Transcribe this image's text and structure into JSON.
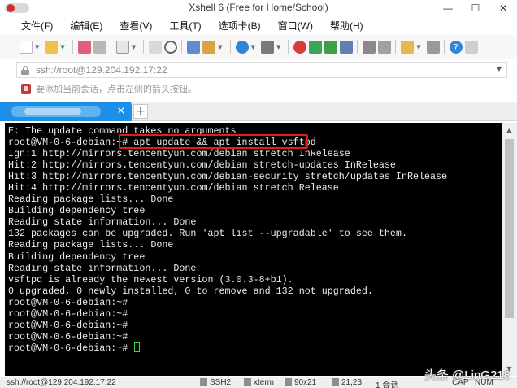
{
  "window": {
    "title": "Xshell 6 (Free for Home/School)",
    "minimize": "—",
    "maximize": "☐",
    "close": "✕"
  },
  "menu": {
    "items": [
      "文件(F)",
      "编辑(E)",
      "查看(V)",
      "工具(T)",
      "选项卡(B)",
      "窗口(W)",
      "帮助(H)"
    ]
  },
  "toolbar": {
    "icons": [
      "new-session-icon",
      "open-folder-icon",
      "reconnect-icon",
      "disconnect-icon",
      "properties-icon",
      "new-window-icon",
      "find-icon",
      "copy-icon",
      "paste-icon",
      "zoom-icon",
      "globe-icon",
      "transfer-icon",
      "xftp-icon",
      "xmanager-icon",
      "compose-icon",
      "keyboard-icon",
      "add-icon",
      "lock-icon",
      "help-icon",
      "chat-icon"
    ]
  },
  "address": {
    "value": "ssh://root@129.204.192.17:22"
  },
  "hint": {
    "text": "要添加当前会话，点击左侧的箭头按钮。"
  },
  "tabs": {
    "add_label": "+",
    "close_label": "×"
  },
  "terminal": {
    "lines": [
      "E: The update command takes no arguments",
      "root@VM-0-6-debian:~# apt update && apt install vsftpd",
      "Ign:1 http://mirrors.tencentyun.com/debian stretch InRelease",
      "Hit:2 http://mirrors.tencentyun.com/debian stretch-updates InRelease",
      "Hit:3 http://mirrors.tencentyun.com/debian-security stretch/updates InRelease",
      "Hit:4 http://mirrors.tencentyun.com/debian stretch Release",
      "Reading package lists... Done",
      "Building dependency tree",
      "Reading state information... Done",
      "132 packages can be upgraded. Run 'apt list --upgradable' to see them.",
      "Reading package lists... Done",
      "Building dependency tree",
      "Reading state information... Done",
      "vsftpd is already the newest version (3.0.3-8+b1).",
      "0 upgraded, 0 newly installed, 0 to remove and 132 not upgraded.",
      "root@VM-0-6-debian:~#",
      "root@VM-0-6-debian:~#",
      "root@VM-0-6-debian:~#",
      "root@VM-0-6-debian:~#",
      "root@VM-0-6-debian:~# "
    ],
    "cursor_color": "#34e034",
    "highlight_color": "#e21b1b"
  },
  "status": {
    "connection": "ssh://root@129.204.192.17:22",
    "protocol": "SSH2",
    "terminal_type": "xterm",
    "size": "90x21",
    "position": "21,23",
    "sessions": "1 会话",
    "caps": "CAP",
    "num": "NUM"
  },
  "watermark": {
    "text": "头条 @LinG218"
  }
}
